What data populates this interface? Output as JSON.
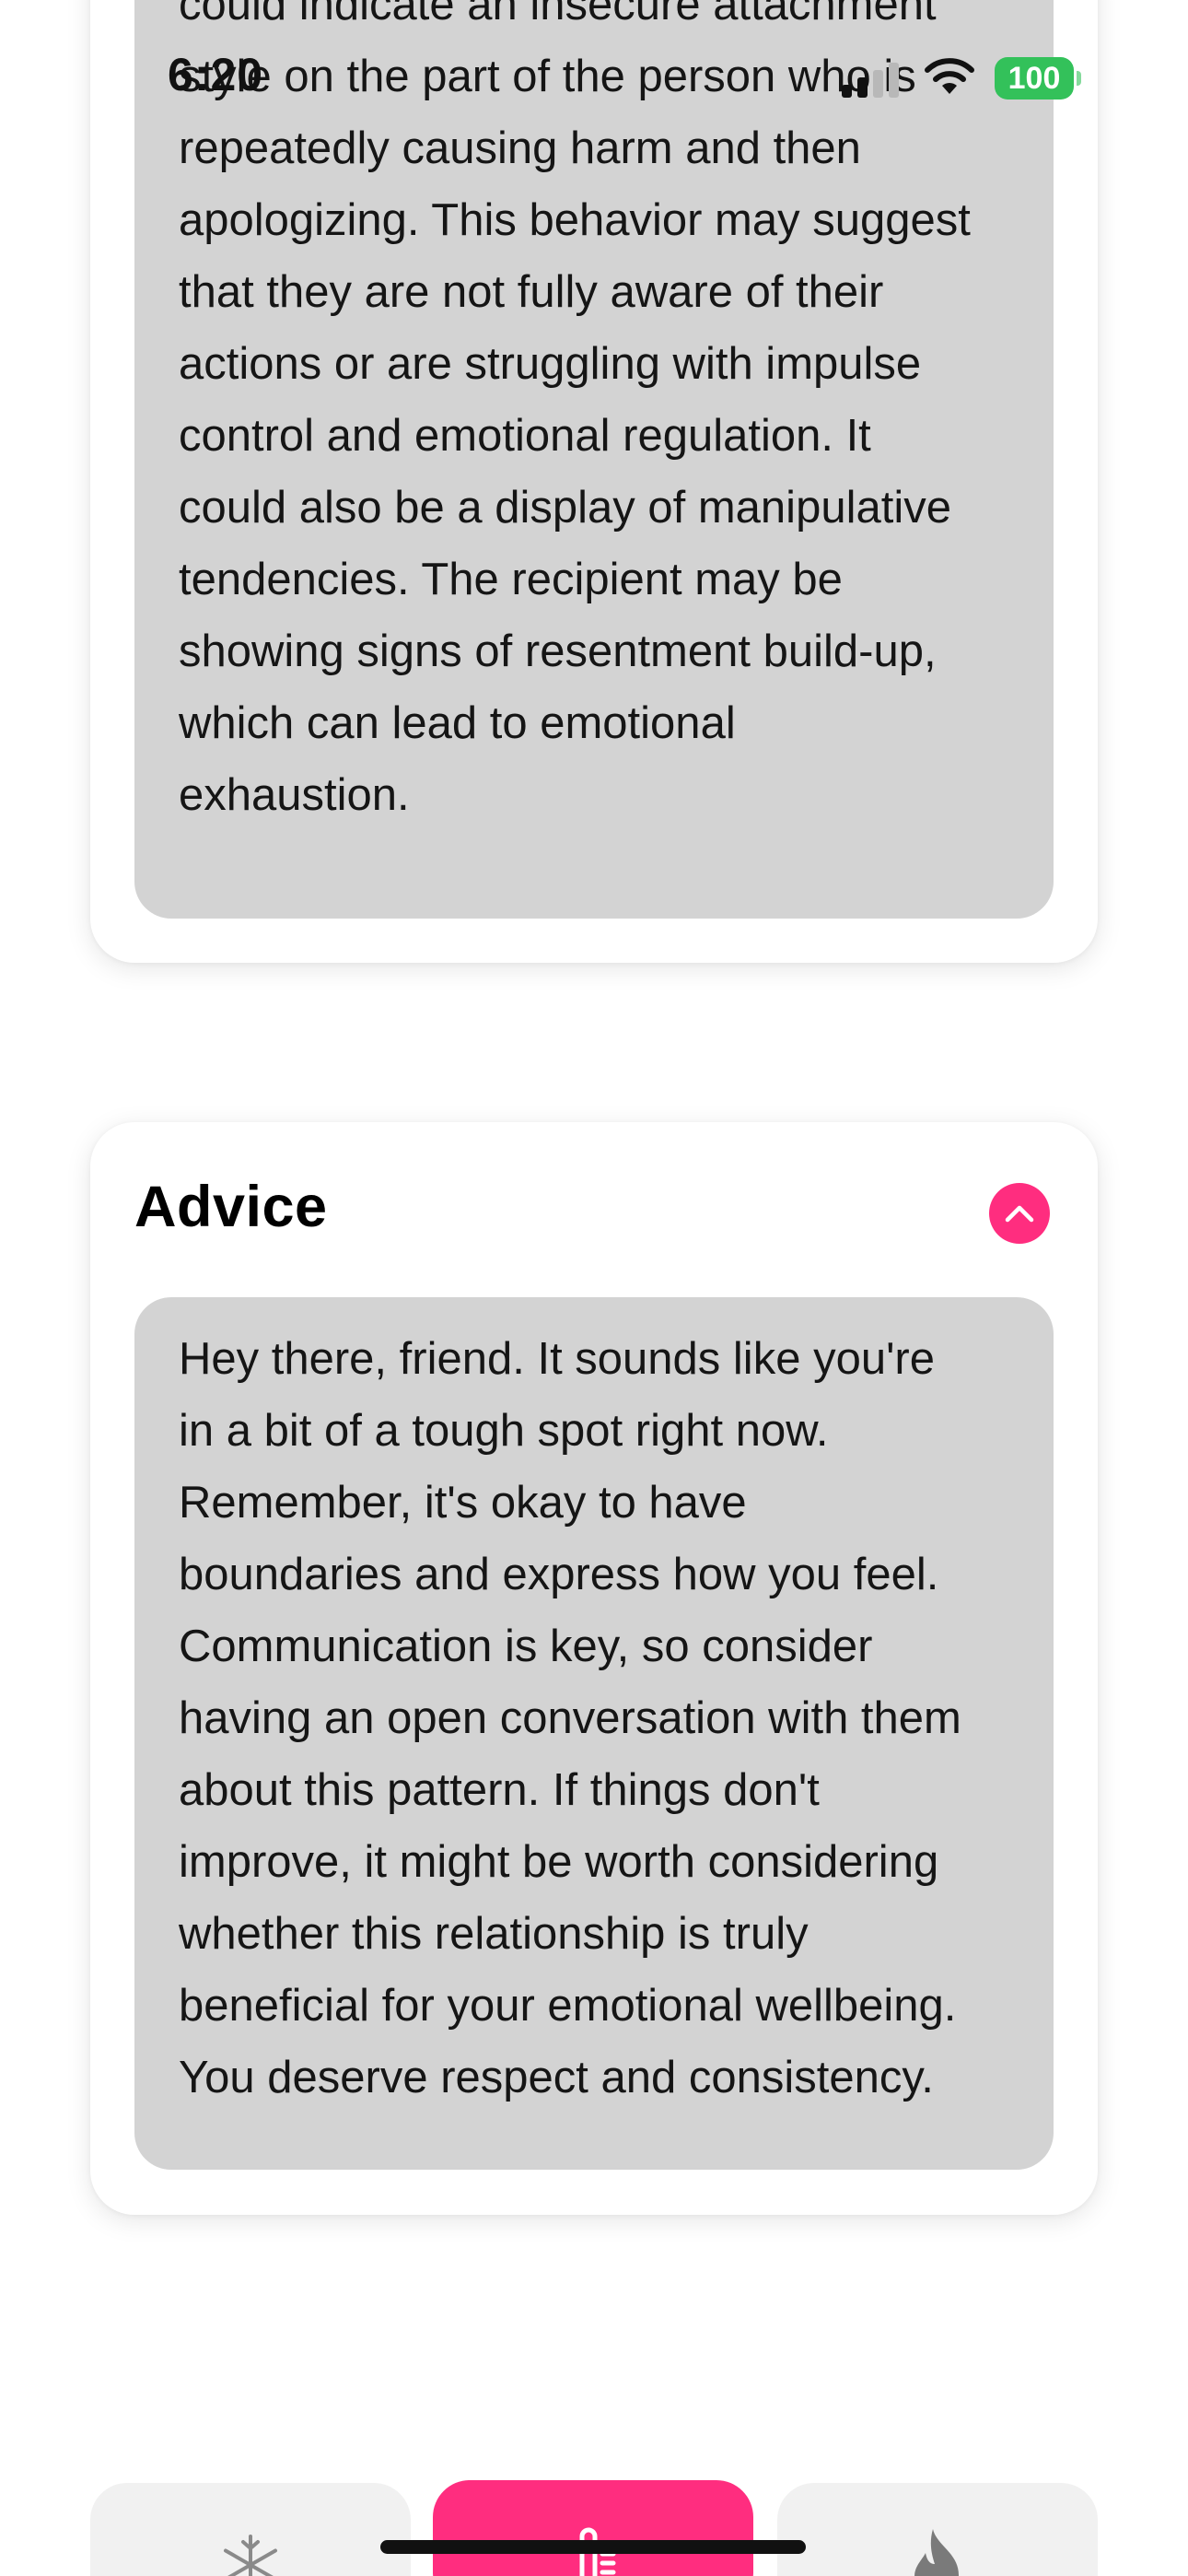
{
  "status_bar": {
    "time": "6:20",
    "battery": "100"
  },
  "analysis_card": {
    "lines": [
      "could indicate an insecure attachment",
      "style on the part of the person who is",
      "repeatedly causing harm and then",
      "apologizing. This behavior may suggest",
      "that they are not fully aware of their",
      "actions or are struggling with impulse",
      "control and emotional regulation. It",
      "could also be a display of manipulative",
      "tendencies. The recipient may be",
      "showing signs of resentment build-up,",
      "which can lead to emotional",
      "exhaustion."
    ]
  },
  "advice_card": {
    "title": "Advice",
    "lines": [
      "Hey there, friend. It sounds like you're",
      "in a bit of a tough spot right now.",
      "Remember, it's okay to have",
      "boundaries and express how you feel.",
      "Communication is key, so consider",
      "having an open conversation with them",
      "about this pattern. If things don't",
      "improve, it might be worth considering",
      "whether this relationship is truly",
      "beneficial for your emotional wellbeing.",
      "You deserve respect and consistency."
    ]
  },
  "tab_bar": {
    "tabs": [
      {
        "icon": "snowflake-icon",
        "active": false
      },
      {
        "icon": "thermometer-icon",
        "active": true
      },
      {
        "icon": "flame-icon",
        "active": false
      }
    ]
  },
  "colors": {
    "accent": "#ff2d7f",
    "text_box": "#d3d3d3",
    "battery": "#33c15a"
  }
}
